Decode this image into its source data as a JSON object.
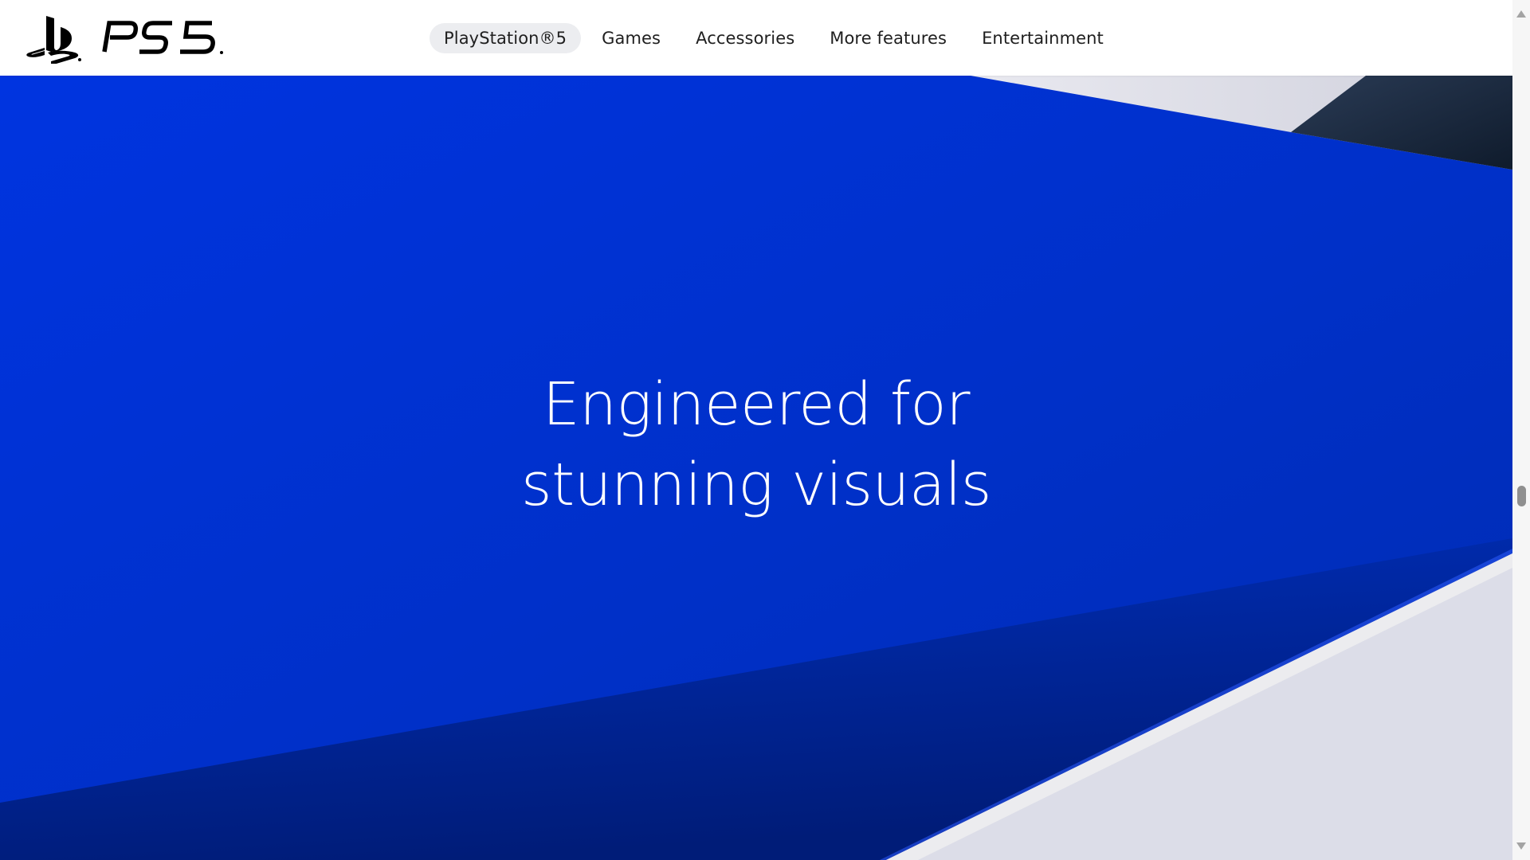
{
  "brand": {
    "logo_name": "PS5",
    "logo_icon": "playstation-logo-icon"
  },
  "nav": {
    "items": [
      {
        "label": "PlayStation®5",
        "active": true
      },
      {
        "label": "Games",
        "active": false
      },
      {
        "label": "Accessories",
        "active": false
      },
      {
        "label": "More features",
        "active": false
      },
      {
        "label": "Entertainment",
        "active": false
      }
    ]
  },
  "hero": {
    "title_line1": "Engineered for",
    "title_line2": "stunning visuals"
  },
  "colors": {
    "hero_blue": "#0033d6",
    "hero_blue_dark": "#001f8a",
    "panel_light": "#dcdde8",
    "text_white": "#ffffff",
    "nav_active_bg": "#ecedf0"
  },
  "scrollbar": {
    "up_icon": "scroll-up-arrow-icon",
    "down_icon": "scroll-down-arrow-icon"
  }
}
